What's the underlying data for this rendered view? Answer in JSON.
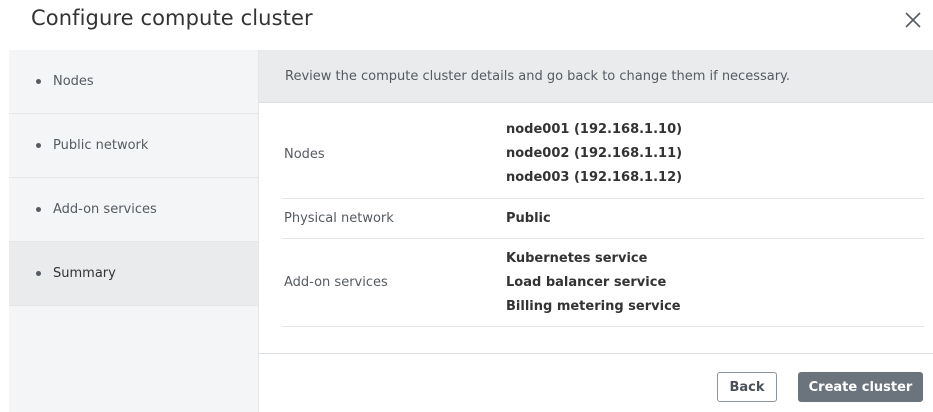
{
  "dialog": {
    "title": "Configure compute cluster",
    "close_icon": "close-icon"
  },
  "sidebar": {
    "items": [
      {
        "label": "Nodes",
        "active": false
      },
      {
        "label": "Public network",
        "active": false
      },
      {
        "label": "Add-on services",
        "active": false
      },
      {
        "label": "Summary",
        "active": true
      }
    ]
  },
  "summary": {
    "banner": "Review the compute cluster details and go back to change them if necessary.",
    "rows": [
      {
        "label": "Nodes",
        "values": [
          "node001 (192.168.1.10)",
          "node002 (192.168.1.11)",
          "node003 (192.168.1.12)"
        ]
      },
      {
        "label": "Physical network",
        "values": [
          "Public"
        ]
      },
      {
        "label": "Add-on services",
        "values": [
          "Kubernetes service",
          "Load balancer service",
          "Billing metering service"
        ]
      }
    ]
  },
  "footer": {
    "back_label": "Back",
    "create_label": "Create cluster"
  },
  "colors": {
    "sidebar_bg": "#f4f5f6",
    "active_bg": "#e9ebed",
    "primary_button": "#6b747c",
    "text": "#333333",
    "muted_text": "#555b61"
  }
}
